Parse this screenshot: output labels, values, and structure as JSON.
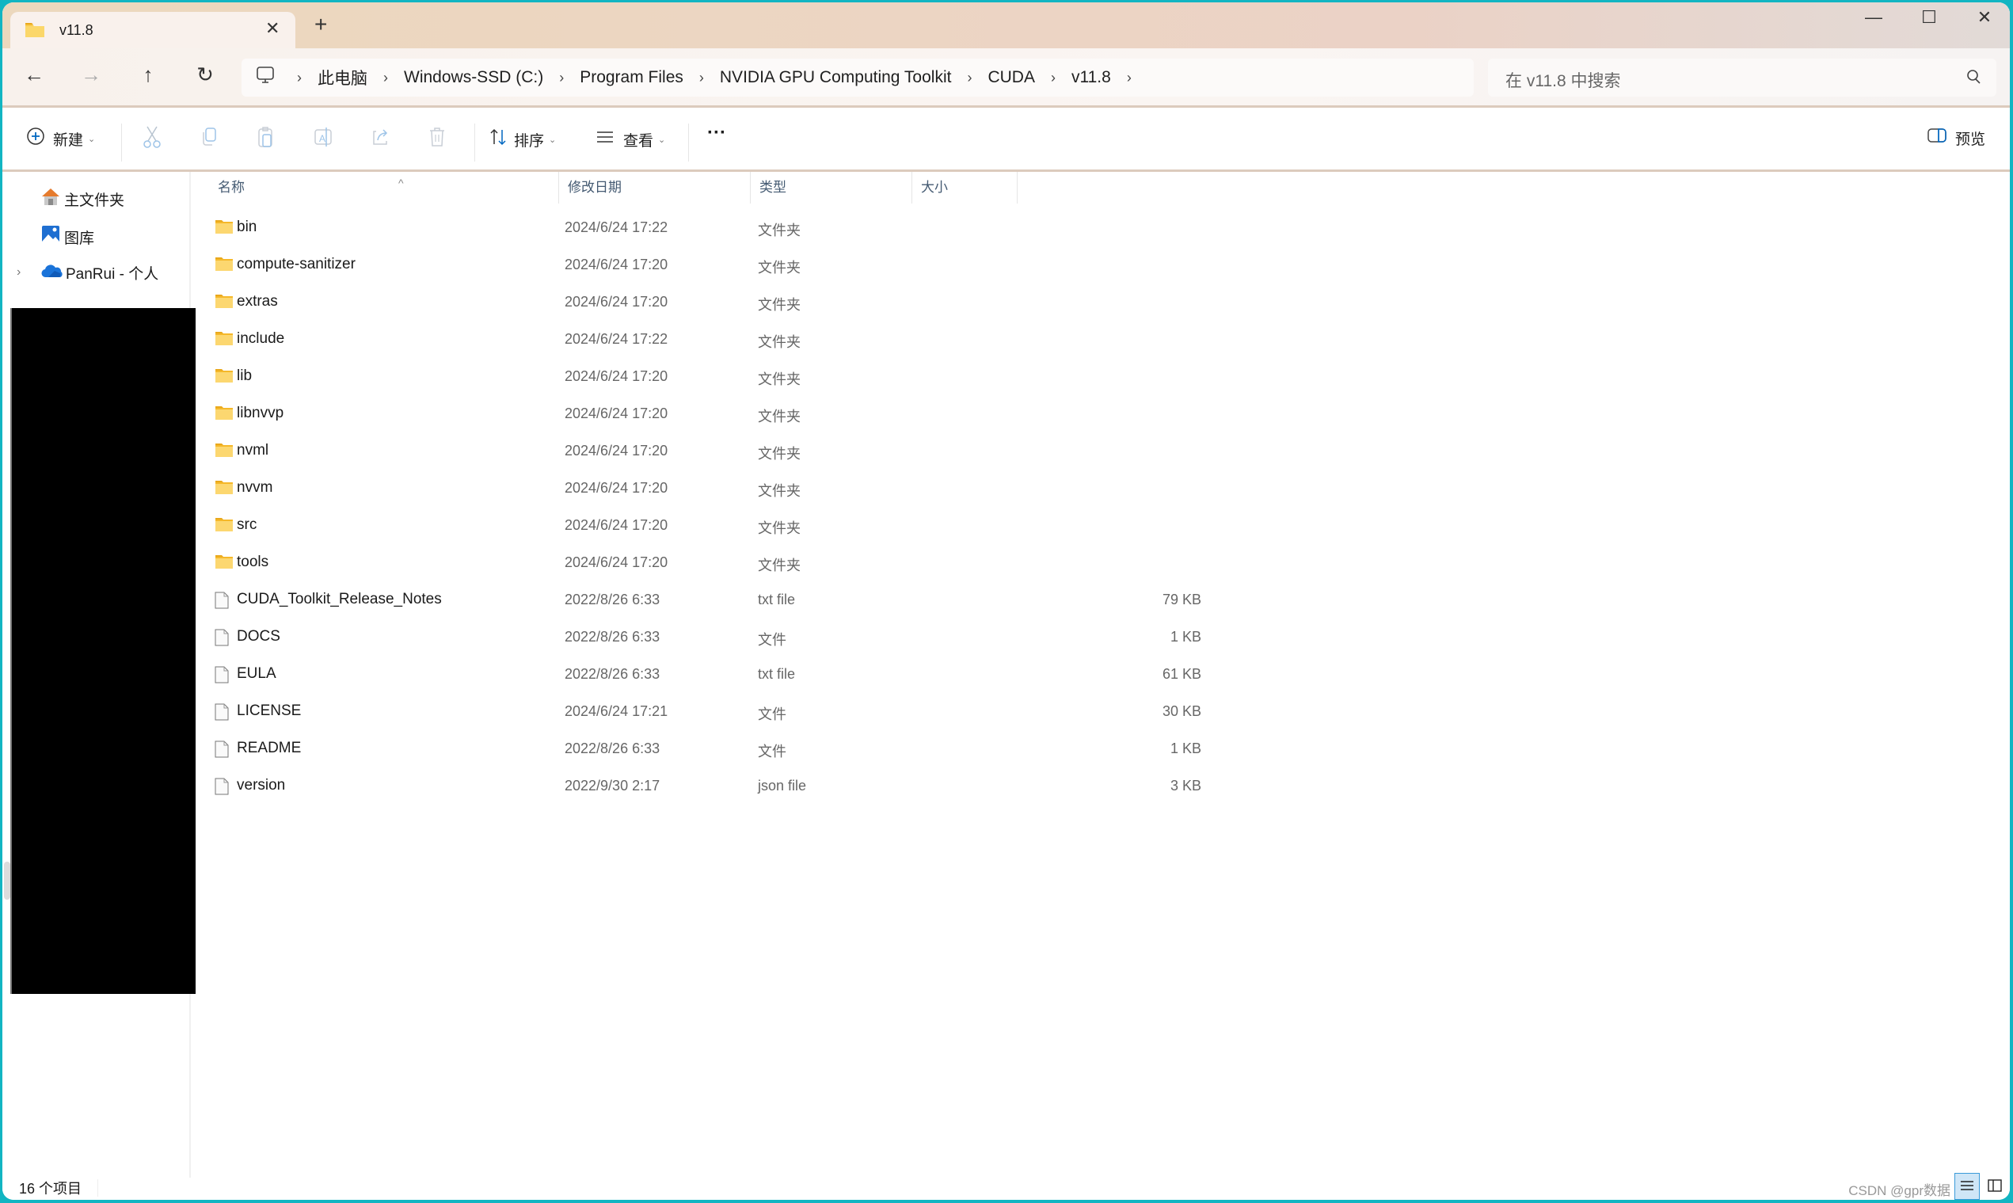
{
  "window": {
    "tab_title": "v11.8",
    "new_tab_label": "+",
    "close_tab_glyph": "✕",
    "controls": {
      "minimize": "—",
      "maximize": "☐",
      "close": "✕"
    }
  },
  "nav": {
    "back": "←",
    "forward": "→",
    "up": "↑",
    "refresh": "↻"
  },
  "breadcrumb": {
    "root_icon": "monitor-icon",
    "segments": [
      "此电脑",
      "Windows-SSD (C:)",
      "Program Files",
      "NVIDIA GPU Computing Toolkit",
      "CUDA",
      "v11.8"
    ],
    "separator": "›"
  },
  "search": {
    "placeholder": "在 v11.8 中搜索"
  },
  "toolbar": {
    "new_label": "新建",
    "sort_label": "排序",
    "view_label": "查看",
    "more_label": "···",
    "preview_label": "预览",
    "disabled_actions": [
      "cut",
      "copy",
      "paste",
      "rename",
      "share",
      "delete"
    ]
  },
  "sidebar": {
    "items": [
      {
        "label": "主文件夹",
        "icon": "home-icon"
      },
      {
        "label": "图库",
        "icon": "gallery-icon"
      },
      {
        "label": "PanRui - 个人",
        "icon": "onedrive-cloud-icon"
      }
    ]
  },
  "columns": {
    "name": "名称",
    "date": "修改日期",
    "type": "类型",
    "size": "大小"
  },
  "files": [
    {
      "name": "bin",
      "date": "2024/6/24 17:22",
      "type": "文件夹",
      "size": "",
      "kind": "folder"
    },
    {
      "name": "compute-sanitizer",
      "date": "2024/6/24 17:20",
      "type": "文件夹",
      "size": "",
      "kind": "folder"
    },
    {
      "name": "extras",
      "date": "2024/6/24 17:20",
      "type": "文件夹",
      "size": "",
      "kind": "folder"
    },
    {
      "name": "include",
      "date": "2024/6/24 17:22",
      "type": "文件夹",
      "size": "",
      "kind": "folder"
    },
    {
      "name": "lib",
      "date": "2024/6/24 17:20",
      "type": "文件夹",
      "size": "",
      "kind": "folder"
    },
    {
      "name": "libnvvp",
      "date": "2024/6/24 17:20",
      "type": "文件夹",
      "size": "",
      "kind": "folder"
    },
    {
      "name": "nvml",
      "date": "2024/6/24 17:20",
      "type": "文件夹",
      "size": "",
      "kind": "folder"
    },
    {
      "name": "nvvm",
      "date": "2024/6/24 17:20",
      "type": "文件夹",
      "size": "",
      "kind": "folder"
    },
    {
      "name": "src",
      "date": "2024/6/24 17:20",
      "type": "文件夹",
      "size": "",
      "kind": "folder"
    },
    {
      "name": "tools",
      "date": "2024/6/24 17:20",
      "type": "文件夹",
      "size": "",
      "kind": "folder"
    },
    {
      "name": "CUDA_Toolkit_Release_Notes",
      "date": "2022/8/26 6:33",
      "type": "txt file",
      "size": "79 KB",
      "kind": "file"
    },
    {
      "name": "DOCS",
      "date": "2022/8/26 6:33",
      "type": "文件",
      "size": "1 KB",
      "kind": "file"
    },
    {
      "name": "EULA",
      "date": "2022/8/26 6:33",
      "type": "txt file",
      "size": "61 KB",
      "kind": "file"
    },
    {
      "name": "LICENSE",
      "date": "2024/6/24 17:21",
      "type": "文件",
      "size": "30 KB",
      "kind": "file"
    },
    {
      "name": "README",
      "date": "2022/8/26 6:33",
      "type": "文件",
      "size": "1 KB",
      "kind": "file"
    },
    {
      "name": "version",
      "date": "2022/9/30 2:17",
      "type": "json file",
      "size": "3 KB",
      "kind": "file"
    }
  ],
  "status": {
    "item_count": "16 个项目",
    "watermark": "CSDN @gpr数据"
  },
  "colors": {
    "window_border": "#12b5c2",
    "accent": "#0067c0",
    "folder": "#f8c94a"
  }
}
